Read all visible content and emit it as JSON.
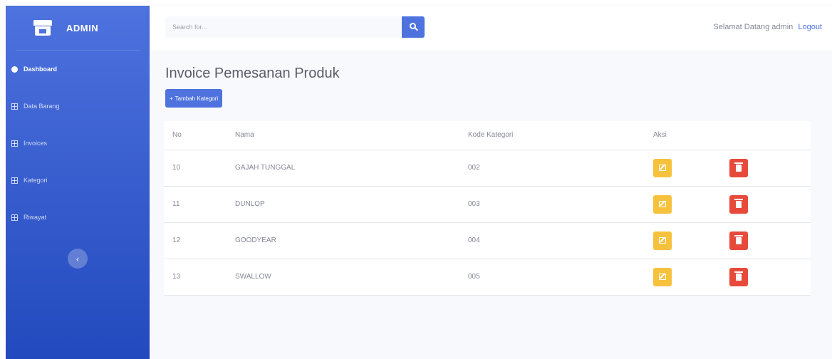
{
  "sidebar": {
    "brand": "ADMIN",
    "items": [
      {
        "label": "Dashboard",
        "icon": "dashboard-icon",
        "active": true
      },
      {
        "label": "Data Barang",
        "icon": "table-icon",
        "active": false
      },
      {
        "label": "Invoices",
        "icon": "table-icon",
        "active": false
      },
      {
        "label": "Kategori",
        "icon": "table-icon",
        "active": false
      },
      {
        "label": "Riwayat",
        "icon": "table-icon",
        "active": false
      }
    ],
    "toggle_glyph": "‹"
  },
  "topbar": {
    "search_placeholder": "Search for...",
    "welcome": "Selamat Datang admin",
    "logout": "Logout"
  },
  "page": {
    "title": "Invoice Pemesanan Produk",
    "add_button": "Tambah Kategori",
    "add_button_icon": "+"
  },
  "table": {
    "headers": [
      "No",
      "Nama",
      "Kode Kategori",
      "Aksi"
    ],
    "rows": [
      {
        "no": "10",
        "nama": "GAJAH TUNGGAL",
        "kode": "002"
      },
      {
        "no": "11",
        "nama": "DUNLOP",
        "kode": "003"
      },
      {
        "no": "12",
        "nama": "GOODYEAR",
        "kode": "004"
      },
      {
        "no": "13",
        "nama": "SWALLOW",
        "kode": "005"
      }
    ]
  },
  "colors": {
    "primary": "#4e73df",
    "warning": "#f6c23e",
    "danger": "#e74a3b",
    "text_muted": "#858796"
  }
}
